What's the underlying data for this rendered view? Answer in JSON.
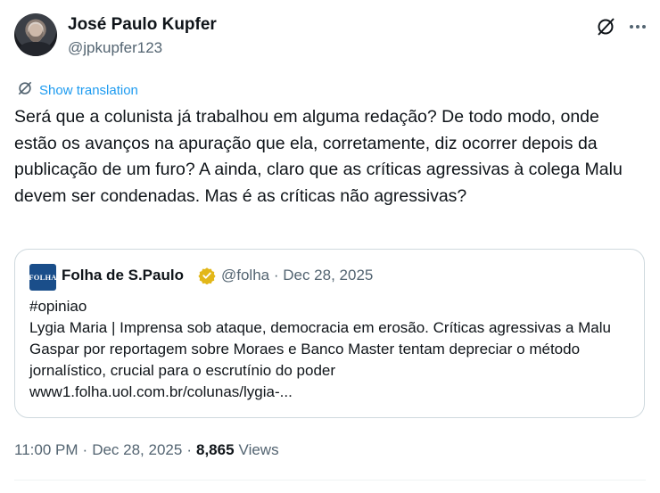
{
  "author": {
    "name": "José Paulo Kupfer",
    "handle": "@jpkupfer123"
  },
  "actions": {
    "grok_icon": "grok-icon",
    "more_icon": "more-icon"
  },
  "translation": {
    "label": "Show translation"
  },
  "tweet": {
    "text": "Será que a colunista já trabalhou em alguma redação? De todo modo, onde estão os avanços na apuração que ela, corretamente, diz ocorrer depois da publicação de um furo? A ainda, claro que as críticas agressivas à colega Malu devem ser condenadas. Mas é as críticas não agressivas?"
  },
  "quote": {
    "logo_text": "FOLHA",
    "name": "Folha de S.Paulo",
    "handle_date": "@folha · Dec 28, 2025",
    "text_lines": [
      "#opiniao",
      "Lygia Maria | Imprensa sob ataque, democracia em erosão. Críticas agressivas a Malu Gaspar por reportagem sobre Moraes e Banco Master tentam depreciar o método jornalístico, crucial para o escrutínio do poder",
      "www1.folha.uol.com.br/colunas/lygia-..."
    ]
  },
  "meta": {
    "time": "11:00 PM",
    "sep1": "·",
    "date": "Dec 28, 2025",
    "sep2": "·",
    "views_count": "8,865",
    "views_label": "Views"
  },
  "colors": {
    "accent": "#1d9bf0",
    "text": "#0f1419",
    "secondary": "#536471",
    "border": "#cfd9de",
    "verified_gold": "#e2b719"
  }
}
